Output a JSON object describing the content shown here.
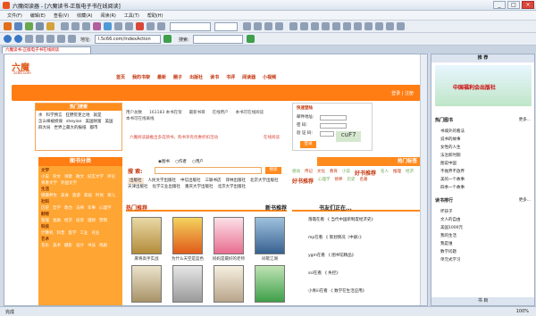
{
  "window": {
    "title": "六魔阅读器 - [六魔读书-正版电子书在线阅读]"
  },
  "menu": [
    "文件(F)",
    "编辑(E)",
    "查看(V)",
    "收藏(A)",
    "阅读(R)",
    "工具(T)",
    "帮助(H)"
  ],
  "address": {
    "label": "地址:",
    "value": "l.5c66.com/IndexAction"
  },
  "search": {
    "label": "搜索:"
  },
  "tab": {
    "label": "六魔读书-正版电子书在线阅读"
  },
  "site": {
    "logo": "六魔",
    "logo_sub": "5c66.com",
    "nav": [
      "首页",
      "我的书架",
      "最新",
      "圈子",
      "出版社",
      "读书",
      "书评",
      "阅读器",
      "小视频"
    ],
    "login_links": "登录 | 注册",
    "hot_title": "热门搜索",
    "hot_terms": [
      "水",
      "科学预言",
      "狂野荒芜之地",
      "就是",
      "怎么样被损毁",
      "sheyian",
      "美国财富",
      "美国",
      "四大局",
      "世界上最大的报纸",
      "都市"
    ],
    "stats": [
      "用户总数",
      "161183 本书在架",
      "最新书目",
      "在线用户",
      "本书可在线阅读",
      "本书可在线离线"
    ],
    "promo": "六魔阅读器推出多选项书，购书享有优惠折扣活动",
    "promo_link": "在线阅读",
    "login_title": "快速登陆",
    "login_fields": [
      "邮件地址:",
      "密    码:",
      "验 证 码:"
    ],
    "captcha": "cuF7",
    "login_button": "登录",
    "cat_title": "图书分类",
    "cats": [
      {
        "name": "文学",
        "items": [
          "小说",
          "杂文",
          "诗歌",
          "散文",
          "纪实文学",
          "评论",
          "青春文学",
          "外国文学",
          "文学鉴赏"
        ]
      },
      {
        "name": "生活",
        "items": [
          "健康养生",
          "美食",
          "旅游",
          "家居",
          "时尚",
          "育儿",
          "两性",
          "宠物"
        ]
      },
      {
        "name": "社科",
        "items": [
          "历史",
          "哲学",
          "政治",
          "法律",
          "军事",
          "心理学",
          "社会学",
          "宗教"
        ]
      },
      {
        "name": "财经",
        "items": [
          "管理",
          "金融",
          "经济",
          "投资",
          "理财",
          "营销",
          "会计"
        ]
      },
      {
        "name": "科技",
        "items": [
          "计算机",
          "科普",
          "医学",
          "工业",
          "农业",
          "建筑",
          "自然科学"
        ]
      },
      {
        "name": "艺术",
        "items": [
          "音乐",
          "美术",
          "摄影",
          "设计",
          "书法",
          "戏剧"
        ]
      }
    ],
    "search_label": "搜  索:",
    "search_opts": [
      "图书",
      "作者",
      "用户"
    ],
    "search_button": "搜索",
    "hot_tags_title": "热门标签",
    "tags": [
      "感动",
      "传记",
      "文化",
      "教育",
      "小说",
      "好书推荐",
      "名人",
      "推理",
      "经济",
      "好书推荐",
      "心理学",
      "修养",
      "历史",
      "名著",
      "出版社"
    ],
    "publishers": [
      "人民文学出版社",
      "中信出版社",
      "三联书店",
      "译林出版社",
      "北京大学出版社",
      "天津出版社",
      "化学工业出版社",
      "重庆大学出版社",
      "北京大学出版社"
    ],
    "publisher_tag": "出版社",
    "rec_title": "热门推荐",
    "new_title": "新书推荐",
    "books": [
      {
        "title": "麻将",
        "sub": "麻将高手实战"
      },
      {
        "title": "为什么",
        "sub": "为什么天空是蓝色"
      },
      {
        "title": "妈妈",
        "sub": "妈妈是最好的老师"
      },
      {
        "title": "间歇江湖",
        "sub": "间歇江湖"
      }
    ],
    "books2": [
      {
        "title": "",
        "sub": ""
      },
      {
        "title": "",
        "sub": ""
      },
      {
        "title": "",
        "sub": ""
      },
      {
        "title": "我换个角度看问题",
        "sub": "我换个角度看问题"
      }
    ],
    "reading_title": "书友们正在...",
    "reading": [
      "落霞在看 《 当代中国新制度经济史》",
      "mp在看 《 策划情况（中册）》",
      "ygm在看 《 图书馆精品》",
      "ssl在看 《 失控》",
      "小青iii在看 《 数学在生活应用》"
    ]
  },
  "right": {
    "sign_title": "推 荐",
    "banner": "中国福利会出版社",
    "hot_books_title": "热门图书",
    "more": "更多...",
    "hot_books": [
      "书城外的看法",
      "说书的故事",
      "女性的人生",
      "法治新时期",
      "图说中国",
      "不抛弃不放弃",
      "美的一个故事",
      "四季一个故事"
    ],
    "rank_title": "读书排行",
    "rank": [
      "坏孩子",
      "文人的自由",
      "美国1000元",
      "我的生活",
      "我是谁",
      "数学问题",
      "单元式学习"
    ],
    "bottom_tab": "书 目"
  },
  "status": {
    "text": "完成",
    "zoom": "100%"
  },
  "colors": {
    "accent": "#ff8a1c",
    "brand": "#e05a1a",
    "link": "#c4350c"
  }
}
